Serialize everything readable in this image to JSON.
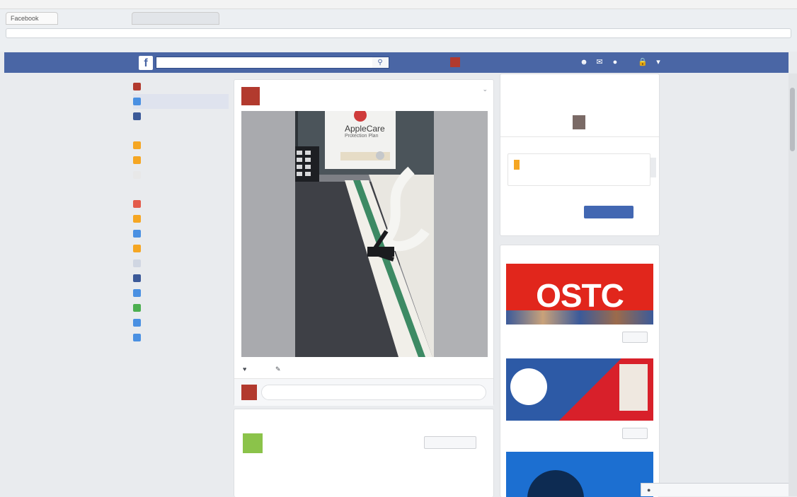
{
  "browser": {
    "tabs": [
      {
        "label": "Facebook"
      },
      {
        "label": ""
      }
    ],
    "address": "",
    "bookmarks": ""
  },
  "fb_header": {
    "logo": "f",
    "search_placeholder": "",
    "profile_name": "",
    "nav_home": "",
    "nav_find_friends": ""
  },
  "left_nav": {
    "profile": "",
    "items": [
      {
        "label": "",
        "count": "",
        "color": "#4a90e2"
      },
      {
        "label": "",
        "count": "",
        "color": "#3b5998"
      }
    ],
    "sections": [
      {
        "header": "",
        "items": [
          {
            "label": "",
            "count": "",
            "color": "#f5a623"
          },
          {
            "label": "",
            "count": "",
            "color": "#f5a623"
          },
          {
            "label": "",
            "count": "",
            "color": "#e8e8e8"
          }
        ]
      },
      {
        "header": "",
        "items": [
          {
            "label": "",
            "count": "",
            "color": "#e35b4b"
          },
          {
            "label": "",
            "count": "",
            "color": "#f5a623"
          },
          {
            "label": "",
            "count": "",
            "color": "#4a90e2"
          },
          {
            "label": "",
            "count": "",
            "color": "#f5a623"
          },
          {
            "label": "",
            "count": "",
            "color": "#d0d6e2"
          },
          {
            "label": "",
            "count": "",
            "color": "#3b5998"
          },
          {
            "label": "",
            "count": "",
            "color": "#4a90e2"
          },
          {
            "label": "",
            "count": "",
            "color": "#4caf50"
          },
          {
            "label": "",
            "count": "",
            "color": "#4a90e2"
          },
          {
            "label": "",
            "count": "",
            "color": "#4a90e2"
          }
        ]
      },
      {
        "header": "",
        "items": [
          {
            "label": "",
            "count": "",
            "color": "#ffffff"
          }
        ]
      }
    ]
  },
  "post": {
    "author": "",
    "timestamp": "",
    "photo": {
      "label_brand": "AppleCare",
      "label_sub": "Protection Plan"
    },
    "like": "",
    "comment": "",
    "comment_placeholder": ""
  },
  "suggested": {
    "header": "",
    "title": "",
    "subtitle": "",
    "action": "",
    "text1": "",
    "text2": ""
  },
  "right_top": {
    "title": "",
    "subtitle": "",
    "section": "",
    "item_title": "",
    "item_sub": "",
    "link": "",
    "button": ""
  },
  "right_ads": {
    "header": "",
    "ads": [
      {
        "title": "",
        "sub": "",
        "banner": "OSTC"
      },
      {
        "title": "",
        "sub": "",
        "banner": ""
      },
      {
        "title": "",
        "sub": "",
        "banner": ""
      }
    ]
  },
  "chat": {
    "label": ""
  },
  "colors": {
    "fb_blue": "#4a66a5",
    "bg": "#e9ebee"
  }
}
